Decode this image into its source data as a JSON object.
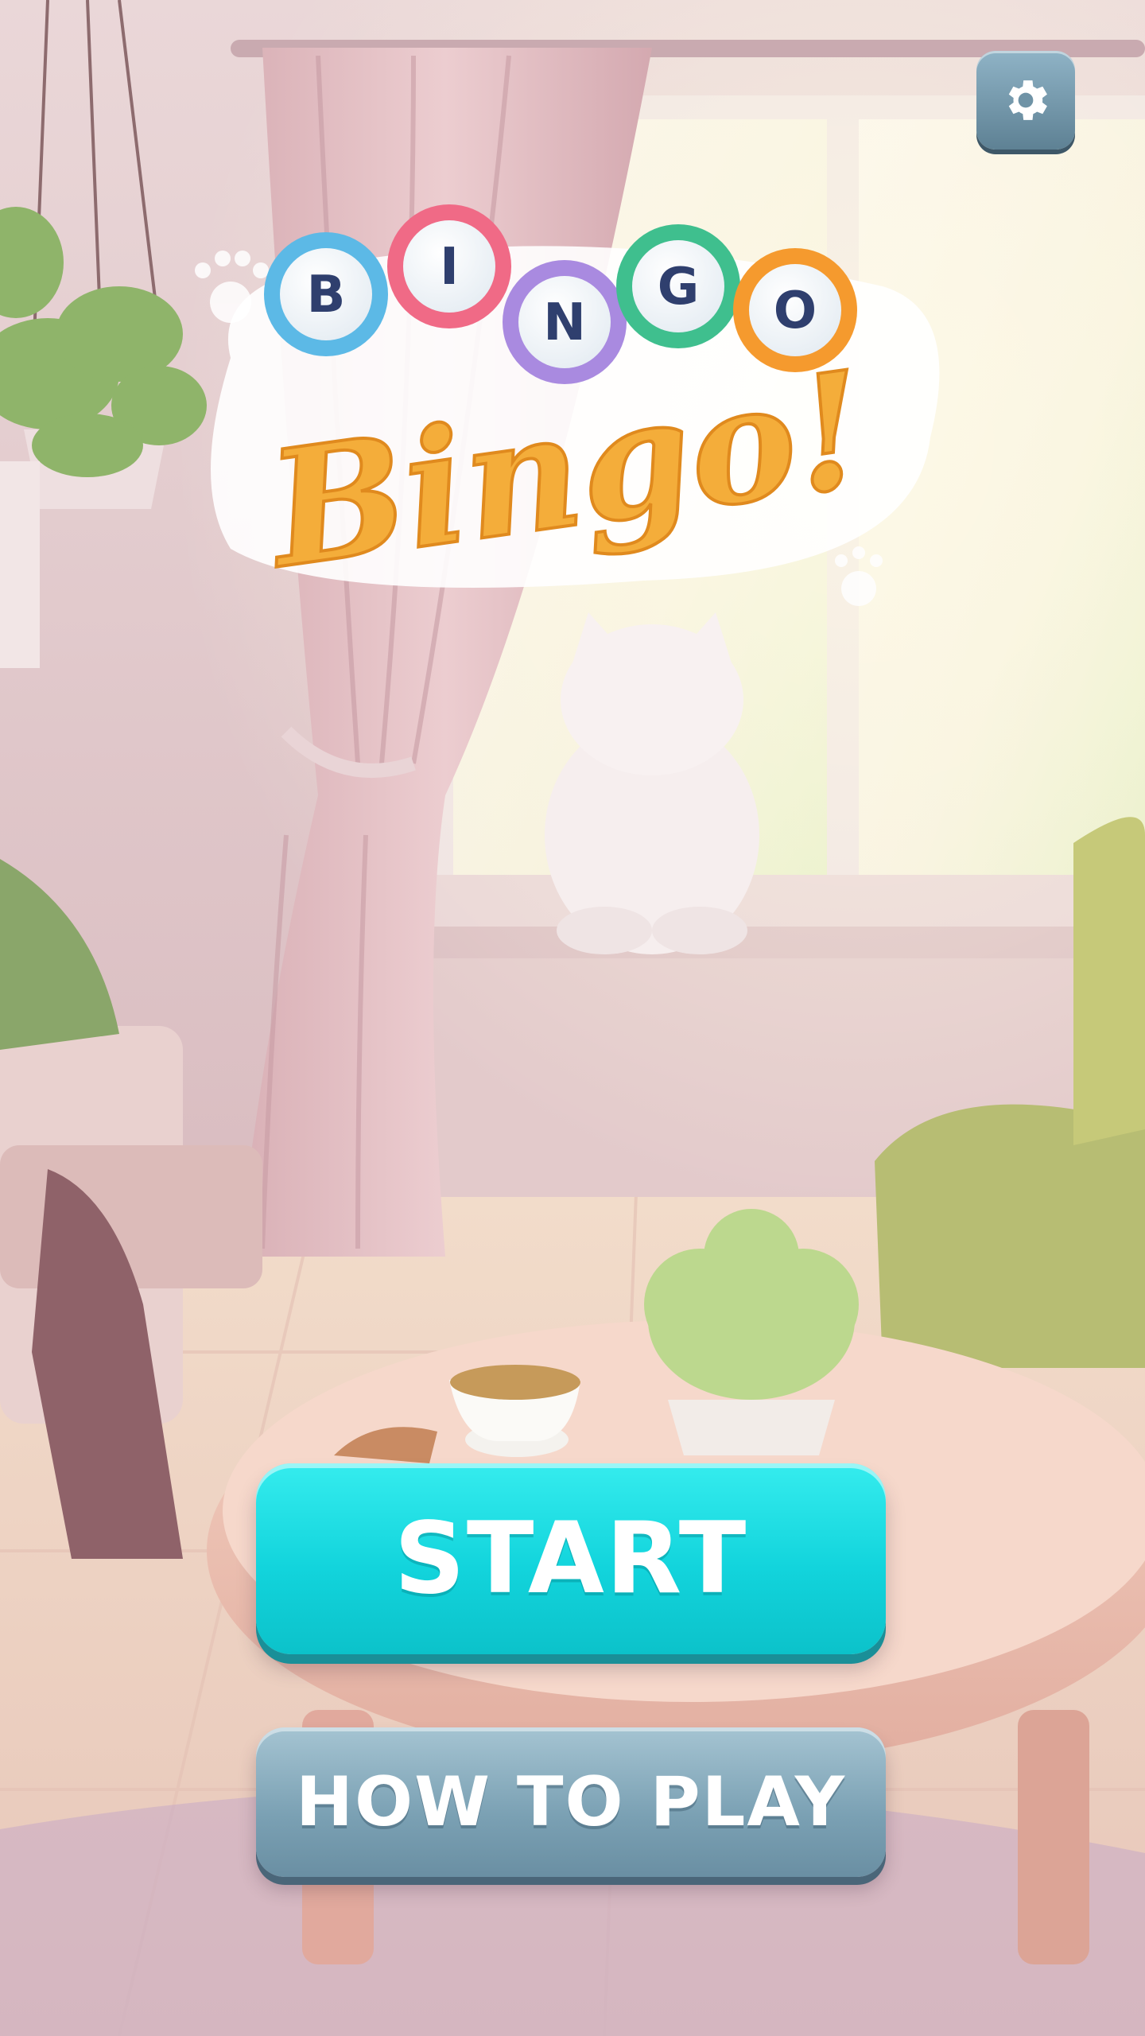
{
  "logo": {
    "ball_letters": [
      "B",
      "I",
      "N",
      "G",
      "O"
    ],
    "script_text": "Bingo!"
  },
  "buttons": {
    "start_label": "START",
    "how_to_play_label": "HOW TO PLAY"
  },
  "icons": {
    "settings": "gear-icon"
  },
  "colors": {
    "start_button": "#12d4dc",
    "how_to_play_button": "#7aa0b3",
    "settings_button": "#6f93a6",
    "logo_script": "#f4ad3a"
  }
}
